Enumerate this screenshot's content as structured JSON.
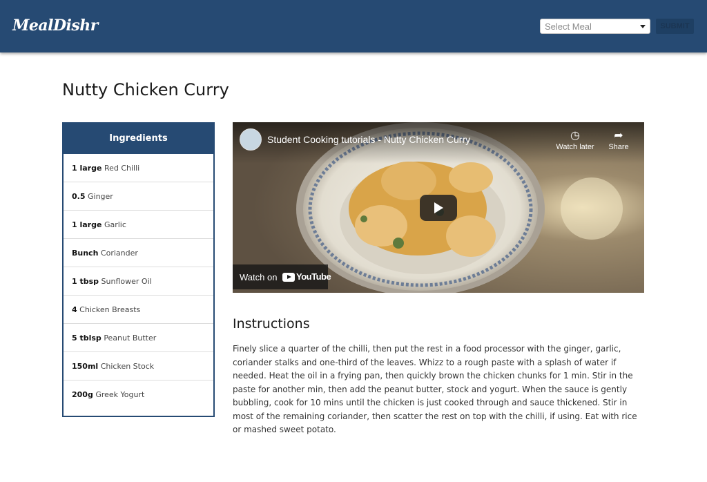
{
  "header": {
    "logo": "MealDishr",
    "select": {
      "placeholder": "Select Meal"
    },
    "submit_label": "SUBMIT"
  },
  "recipe": {
    "title": "Nutty Chicken Curry",
    "ingredients_heading": "Ingredients",
    "ingredients": [
      {
        "qty": "1 large",
        "name": "Red Chilli"
      },
      {
        "qty": "0.5",
        "name": "Ginger"
      },
      {
        "qty": "1 large",
        "name": "Garlic"
      },
      {
        "qty": "Bunch",
        "name": "Coriander"
      },
      {
        "qty": "1 tbsp",
        "name": "Sunflower Oil"
      },
      {
        "qty": "4",
        "name": "Chicken Breasts"
      },
      {
        "qty": "5 tblsp",
        "name": "Peanut Butter"
      },
      {
        "qty": "150ml",
        "name": "Chicken Stock"
      },
      {
        "qty": "200g",
        "name": "Greek Yogurt"
      }
    ],
    "video": {
      "title": "Student Cooking tutorials - Nutty Chicken Curry",
      "watch_later": "Watch later",
      "share": "Share",
      "watch_on": "Watch on",
      "youtube": "YouTube"
    },
    "instructions_heading": "Instructions",
    "instructions": "Finely slice a quarter of the chilli, then put the rest in a food processor with the ginger, garlic, coriander stalks and one-third of the leaves. Whizz to a rough paste with a splash of water if needed. Heat the oil in a frying pan, then quickly brown the chicken chunks for 1 min. Stir in the paste for another min, then add the peanut butter, stock and yogurt. When the sauce is gently bubbling, cook for 10 mins until the chicken is just cooked through and sauce thickened. Stir in most of the remaining coriander, then scatter the rest on top with the chilli, if using. Eat with rice or mashed sweet potato."
  },
  "colors": {
    "brand": "#264a73",
    "submit_bg": "#1e3f63"
  }
}
